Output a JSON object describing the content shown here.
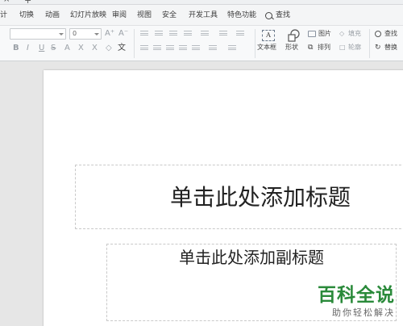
{
  "tabstrip": {
    "tab_fragment": "×",
    "new_tab": "+"
  },
  "menu": {
    "items": [
      "计",
      "切换",
      "动画",
      "幻灯片放映",
      "审阅",
      "视图",
      "安全",
      "开发工具",
      "特色功能"
    ],
    "search_label": "查找"
  },
  "ribbon": {
    "font_size_value": "0",
    "grow_font": "A⁺",
    "shrink_font": "A⁻",
    "bold": "B",
    "italic": "I",
    "underline": "U",
    "strike": "S",
    "text_box_label": "文本框",
    "text_box_icon_text": "A",
    "shape_label": "形状",
    "picture_label": "图片",
    "fill_label": "填充",
    "arrange_label": "排列",
    "outline_label": "轮廓",
    "find_label": "查找",
    "replace_label": "替换"
  },
  "slide": {
    "title_placeholder": "单击此处添加标题",
    "subtitle_placeholder": "单击此处添加副标题"
  },
  "watermark": {
    "main": "百科全说",
    "sub": "助你轻松解决"
  },
  "colors": {
    "watermark_green": "#2a8a3a",
    "slide_bg": "#ffffff",
    "workspace_bg": "#e6e6e6"
  }
}
